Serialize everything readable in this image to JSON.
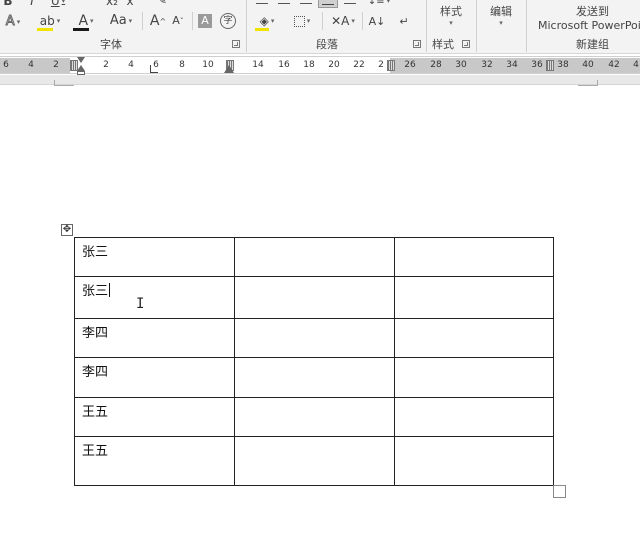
{
  "ribbon": {
    "font_group": {
      "label": "字体",
      "bold": "B",
      "italic": "I",
      "underline": "U",
      "subscript": "x₂",
      "superscript": "x",
      "font_color": "A",
      "change_case": "Aa",
      "grow_font": "A",
      "shrink_font": "A",
      "char_shading": "A",
      "enclose_char": "字",
      "text_effects": "A"
    },
    "paragraph_group": {
      "label": "段落"
    },
    "styles_group": {
      "label": "样式",
      "button_label": "样式"
    },
    "editing_group": {
      "button_label": "编辑"
    },
    "send_group": {
      "label": "新建组",
      "line1": "发送到",
      "line2": "Microsoft PowerPoi"
    },
    "colors": {
      "font_color_underline": "#1a1a1a",
      "highlight_underline": "#f2e200"
    }
  },
  "ruler": {
    "left_ticks": [
      "6",
      "4",
      "2"
    ],
    "right_ticks": [
      "2",
      "4",
      "6",
      "8",
      "10",
      "14",
      "16",
      "18",
      "20",
      "22",
      "2",
      "26",
      "28",
      "30",
      "32",
      "34",
      "36",
      "38",
      "40",
      "42",
      "4"
    ]
  },
  "table": {
    "rows": [
      [
        "张三",
        "",
        ""
      ],
      [
        "张三",
        "",
        ""
      ],
      [
        "李四",
        "",
        ""
      ],
      [
        "李四",
        "",
        ""
      ],
      [
        "王五",
        "",
        ""
      ],
      [
        "王五",
        "",
        ""
      ]
    ]
  }
}
